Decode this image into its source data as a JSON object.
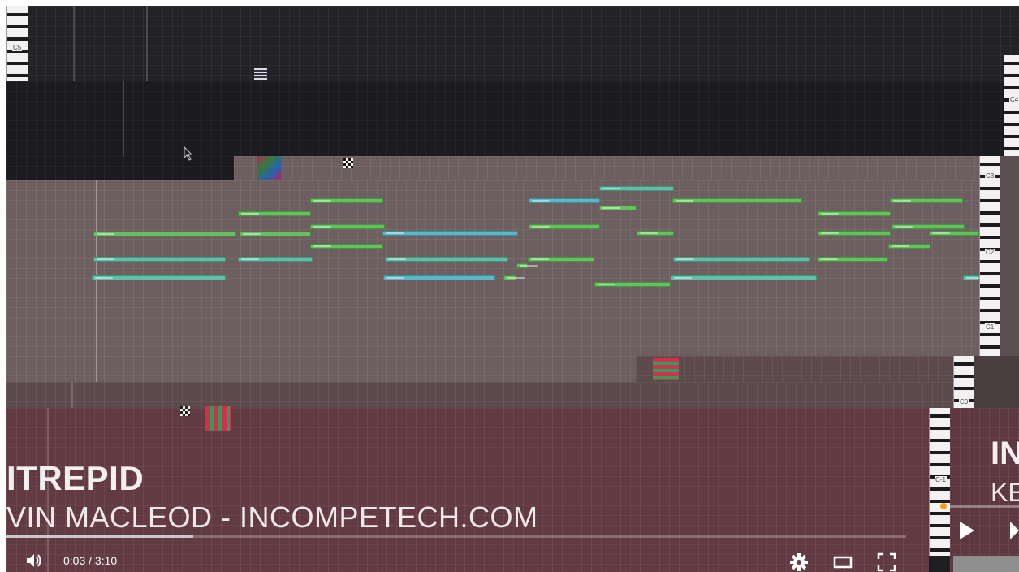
{
  "video": {
    "title": "ITREPID",
    "subtitle": "VIN MACLEOD - INCOMPETECH.COM",
    "side_title": "IN",
    "side_subtitle": "KE"
  },
  "player": {
    "time_display": "0:03 / 3:10",
    "progress_fraction": 0.02,
    "icons": {
      "volume": "volume-icon",
      "settings": "gear-icon",
      "theater": "theater-mode-icon",
      "fullscreen": "fullscreen-icon",
      "play": "play-icon"
    }
  },
  "piano_roll": {
    "key_labels": {
      "top": "C5",
      "upper_right": "C4",
      "c3": "C3",
      "c2": "C2",
      "c1": "C1",
      "c0": "C0",
      "cneg1": "C-1"
    }
  },
  "colors": {
    "note_green": "#62c25c",
    "note_teal": "#5fbfa9",
    "note_cyan": "#58b8c8",
    "roll_bg": "#6d5f60",
    "bottom_bg": "#623a41",
    "accent": "#f0a020"
  }
}
